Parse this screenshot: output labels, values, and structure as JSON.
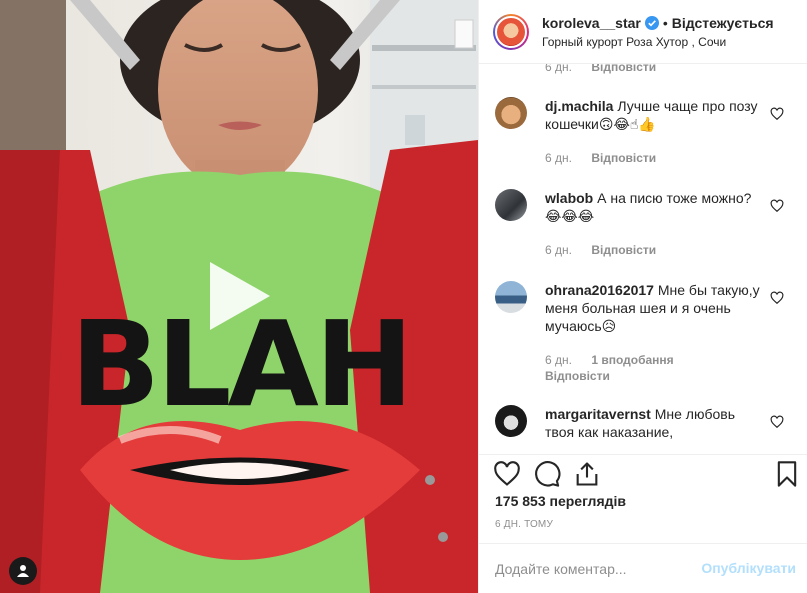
{
  "header": {
    "username": "koroleva__star",
    "separator": "•",
    "follow_label": "Відстежується",
    "location": "Горный курорт Роза Хутор , Сочи"
  },
  "comments": {
    "cut_row": {
      "time": "6 дн.",
      "reply": "Відповісти"
    },
    "items": [
      {
        "username": "dj.machila",
        "text": "Лучше чаще про позу кошечки🙃😂☝👍",
        "time": "6 дн.",
        "reply": "Відповісти"
      },
      {
        "username": "wlabob",
        "text": "А на писю тоже можно? 😂😂😂",
        "time": "6 дн.",
        "reply": "Відповісти"
      },
      {
        "username": "ohrana20162017",
        "text": "Мне бы такую,у меня больная шея и я очень мучаюсь😥",
        "time": "6 дн.",
        "likes": "1 вподобання",
        "reply": "Відповісти"
      },
      {
        "username": "margaritavernst",
        "text": "Мне любовь твоя как наказание,",
        "time": "",
        "reply": ""
      }
    ]
  },
  "stats": {
    "views": "175 853 переглядів",
    "time_ago": "6 ДН. ТОМУ"
  },
  "add_comment": {
    "placeholder": "Додайте коментар...",
    "post_label": "Опублікувати"
  },
  "media": {
    "shirt_text": "BLAH"
  },
  "colors": {
    "verified": "#3897f0",
    "post_disabled": "#b2dffc",
    "secondary_text": "#8e8e8e",
    "cardigan": "#c8262a",
    "shirt": "#8fd46a"
  },
  "icons": {
    "play": "play-icon",
    "user_tag": "person-icon",
    "like": "heart-icon",
    "comment": "comment-bubble-icon",
    "share": "share-icon",
    "save": "bookmark-icon"
  }
}
